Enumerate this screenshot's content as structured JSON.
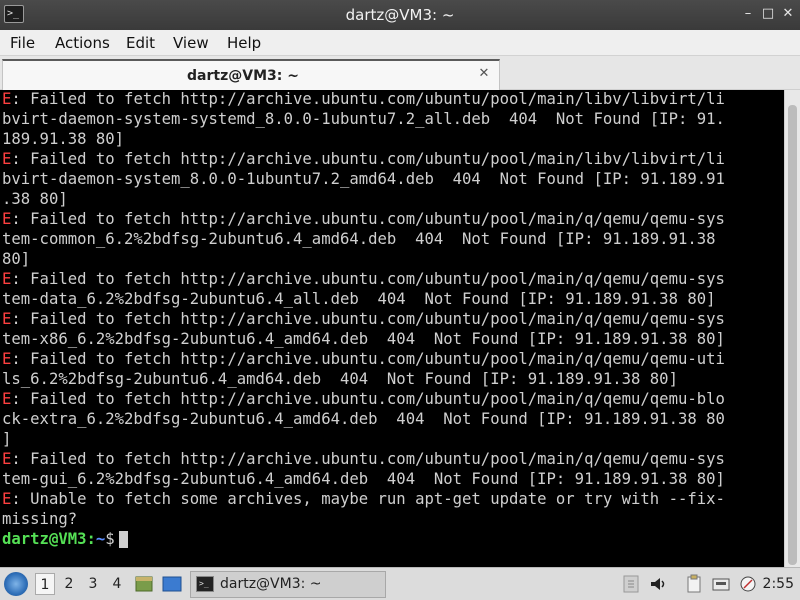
{
  "window": {
    "title": "dartz@VM3: ~",
    "minimize_glyph": "–",
    "maximize_glyph": "□",
    "close_glyph": "✕"
  },
  "menu": {
    "file": "File",
    "actions": "Actions",
    "edit": "Edit",
    "view": "View",
    "help": "Help"
  },
  "tab": {
    "label": "dartz@VM3: ~",
    "close_glyph": "✕"
  },
  "terminal": {
    "error_prefix": "E",
    "lines": [
      {
        "prefix": "E",
        "text": ": Failed to fetch http://archive.ubuntu.com/ubuntu/pool/main/libv/libvirt/li"
      },
      {
        "prefix": "",
        "text": "bvirt-daemon-system-systemd_8.0.0-1ubuntu7.2_all.deb  404  Not Found [IP: 91."
      },
      {
        "prefix": "",
        "text": "189.91.38 80]"
      },
      {
        "prefix": "E",
        "text": ": Failed to fetch http://archive.ubuntu.com/ubuntu/pool/main/libv/libvirt/li"
      },
      {
        "prefix": "",
        "text": "bvirt-daemon-system_8.0.0-1ubuntu7.2_amd64.deb  404  Not Found [IP: 91.189.91"
      },
      {
        "prefix": "",
        "text": ".38 80]"
      },
      {
        "prefix": "E",
        "text": ": Failed to fetch http://archive.ubuntu.com/ubuntu/pool/main/q/qemu/qemu-sys"
      },
      {
        "prefix": "",
        "text": "tem-common_6.2%2bdfsg-2ubuntu6.4_amd64.deb  404  Not Found [IP: 91.189.91.38"
      },
      {
        "prefix": "",
        "text": "80]"
      },
      {
        "prefix": "E",
        "text": ": Failed to fetch http://archive.ubuntu.com/ubuntu/pool/main/q/qemu/qemu-sys"
      },
      {
        "prefix": "",
        "text": "tem-data_6.2%2bdfsg-2ubuntu6.4_all.deb  404  Not Found [IP: 91.189.91.38 80]"
      },
      {
        "prefix": "E",
        "text": ": Failed to fetch http://archive.ubuntu.com/ubuntu/pool/main/q/qemu/qemu-sys"
      },
      {
        "prefix": "",
        "text": "tem-x86_6.2%2bdfsg-2ubuntu6.4_amd64.deb  404  Not Found [IP: 91.189.91.38 80]"
      },
      {
        "prefix": "E",
        "text": ": Failed to fetch http://archive.ubuntu.com/ubuntu/pool/main/q/qemu/qemu-uti"
      },
      {
        "prefix": "",
        "text": "ls_6.2%2bdfsg-2ubuntu6.4_amd64.deb  404  Not Found [IP: 91.189.91.38 80]"
      },
      {
        "prefix": "E",
        "text": ": Failed to fetch http://archive.ubuntu.com/ubuntu/pool/main/q/qemu/qemu-blo"
      },
      {
        "prefix": "",
        "text": "ck-extra_6.2%2bdfsg-2ubuntu6.4_amd64.deb  404  Not Found [IP: 91.189.91.38 80"
      },
      {
        "prefix": "",
        "text": "]"
      },
      {
        "prefix": "E",
        "text": ": Failed to fetch http://archive.ubuntu.com/ubuntu/pool/main/q/qemu/qemu-sys"
      },
      {
        "prefix": "",
        "text": "tem-gui_6.2%2bdfsg-2ubuntu6.4_amd64.deb  404  Not Found [IP: 91.189.91.38 80]"
      },
      {
        "prefix": "E",
        "text": ": Unable to fetch some archives, maybe run apt-get update or try with --fix-"
      },
      {
        "prefix": "",
        "text": "missing?"
      }
    ],
    "prompt": {
      "user_host": "dartz@VM3",
      "separator": ":",
      "path": "~",
      "symbol": "$"
    }
  },
  "taskbar": {
    "desktops": [
      "1",
      "2",
      "3",
      "4"
    ],
    "active_desktop": "1",
    "task_label": "dartz@VM3: ~",
    "clock": "2:55"
  }
}
